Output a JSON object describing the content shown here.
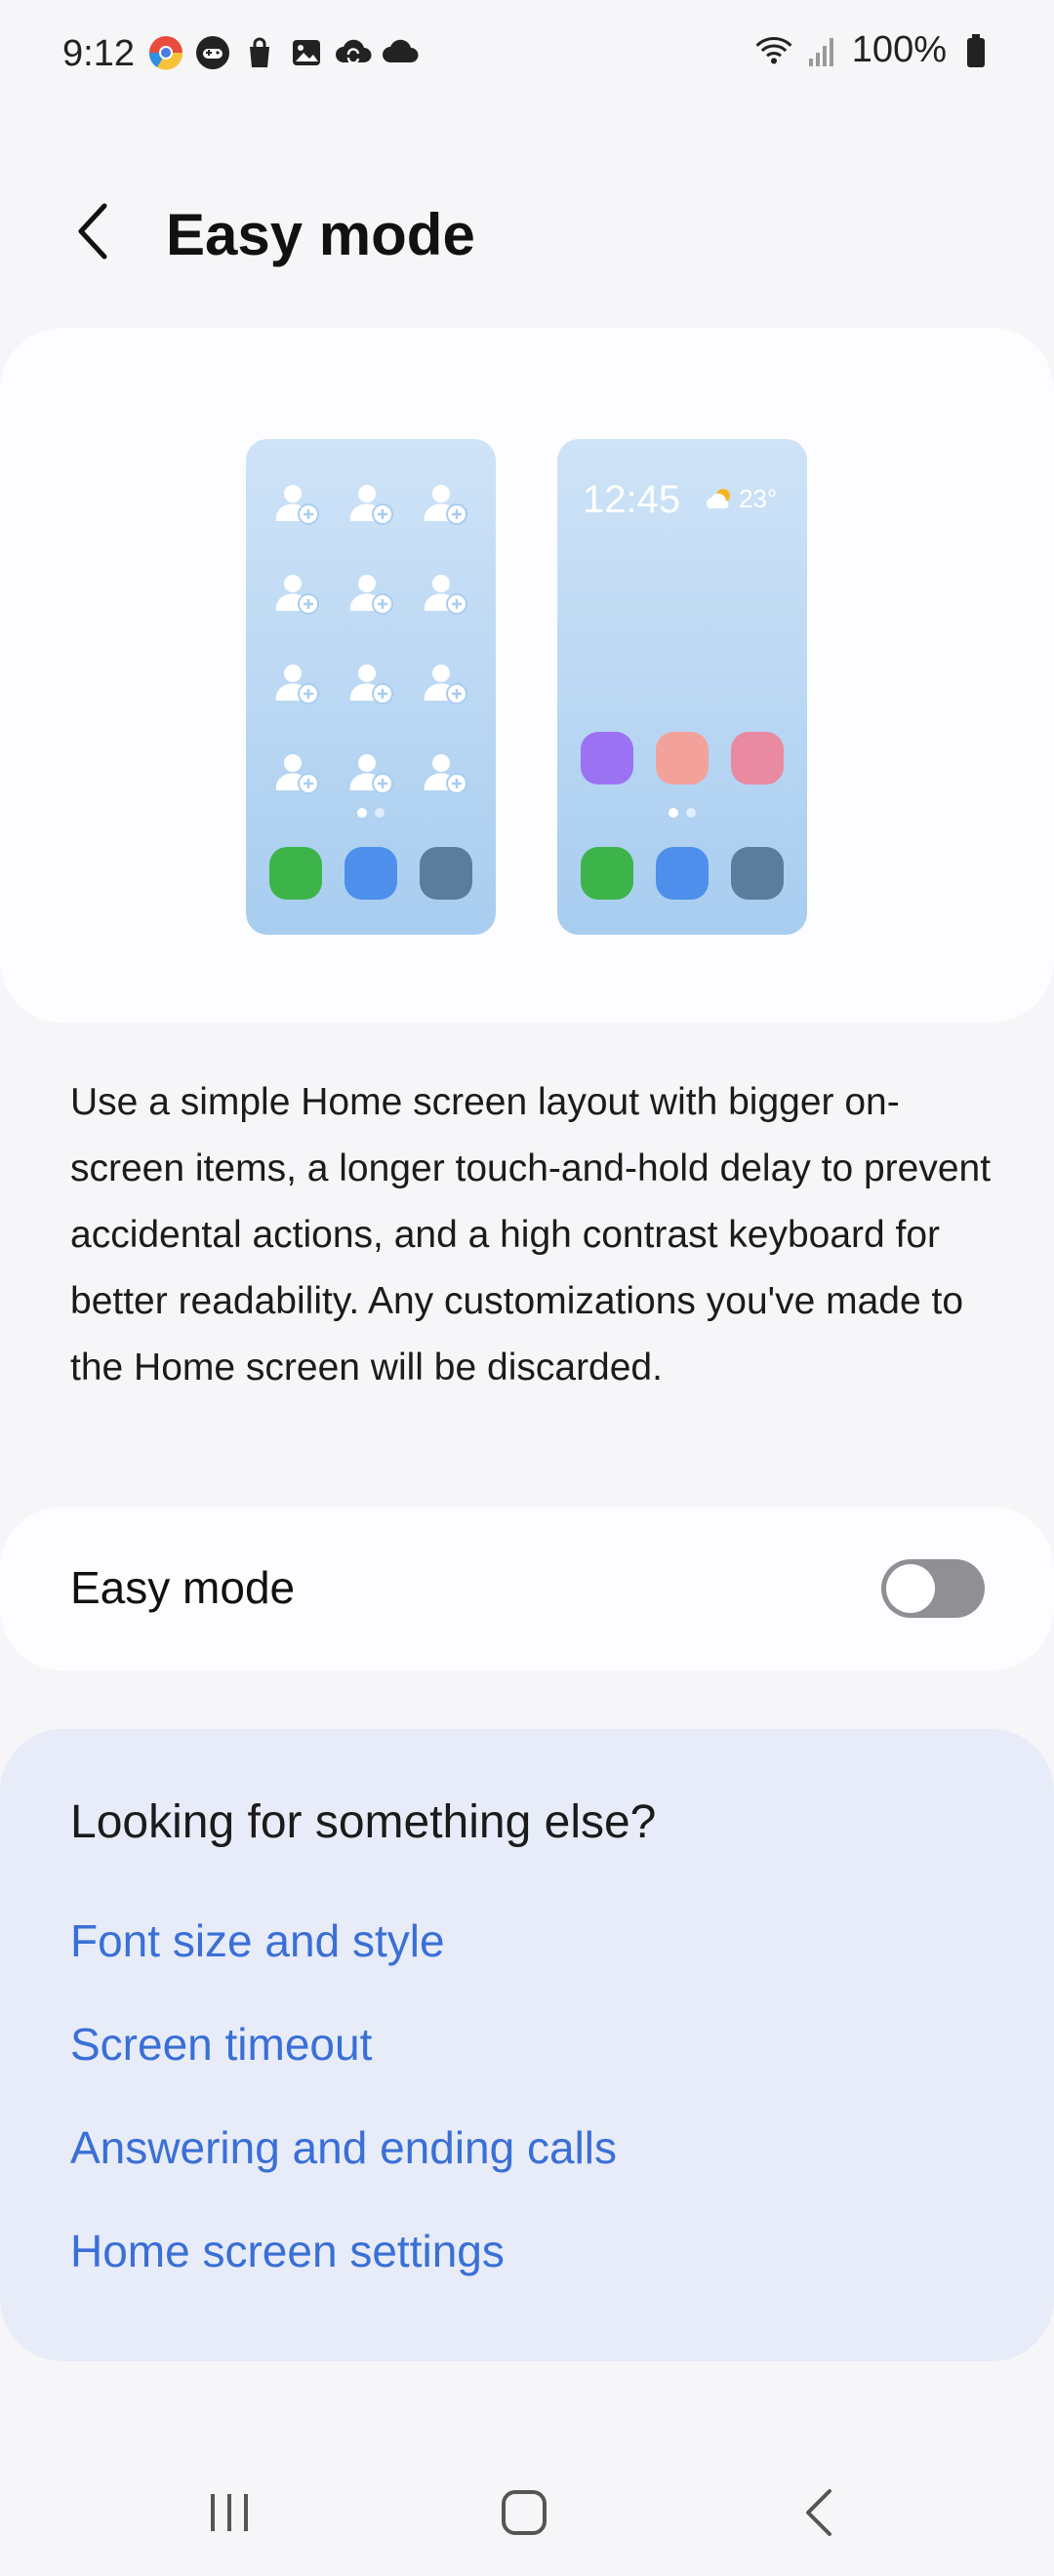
{
  "status_bar": {
    "time": "9:12",
    "battery": "100%"
  },
  "header": {
    "title": "Easy mode"
  },
  "preview": {
    "clock": "12:45",
    "temperature": "23°",
    "colors": {
      "green": "#3cb44a",
      "blue": "#4e8fec",
      "slate": "#5a7d9b",
      "purple": "#9b72f2",
      "salmon": "#f2a29b",
      "pink": "#ea8aa2"
    }
  },
  "description": "Use a simple Home screen layout with bigger on-screen items, a longer touch-and-hold delay to prevent accidental actions, and a high contrast keyboard for better readability. Any customizations you've made to the Home screen will be discarded.",
  "toggle": {
    "label": "Easy mode",
    "state": "off"
  },
  "suggestions": {
    "title": "Looking for something else?",
    "links": [
      "Font size and style",
      "Screen timeout",
      "Answering and ending calls",
      "Home screen settings"
    ]
  },
  "nav": {
    "icons": [
      "recents-icon",
      "home-icon",
      "back-icon"
    ]
  }
}
